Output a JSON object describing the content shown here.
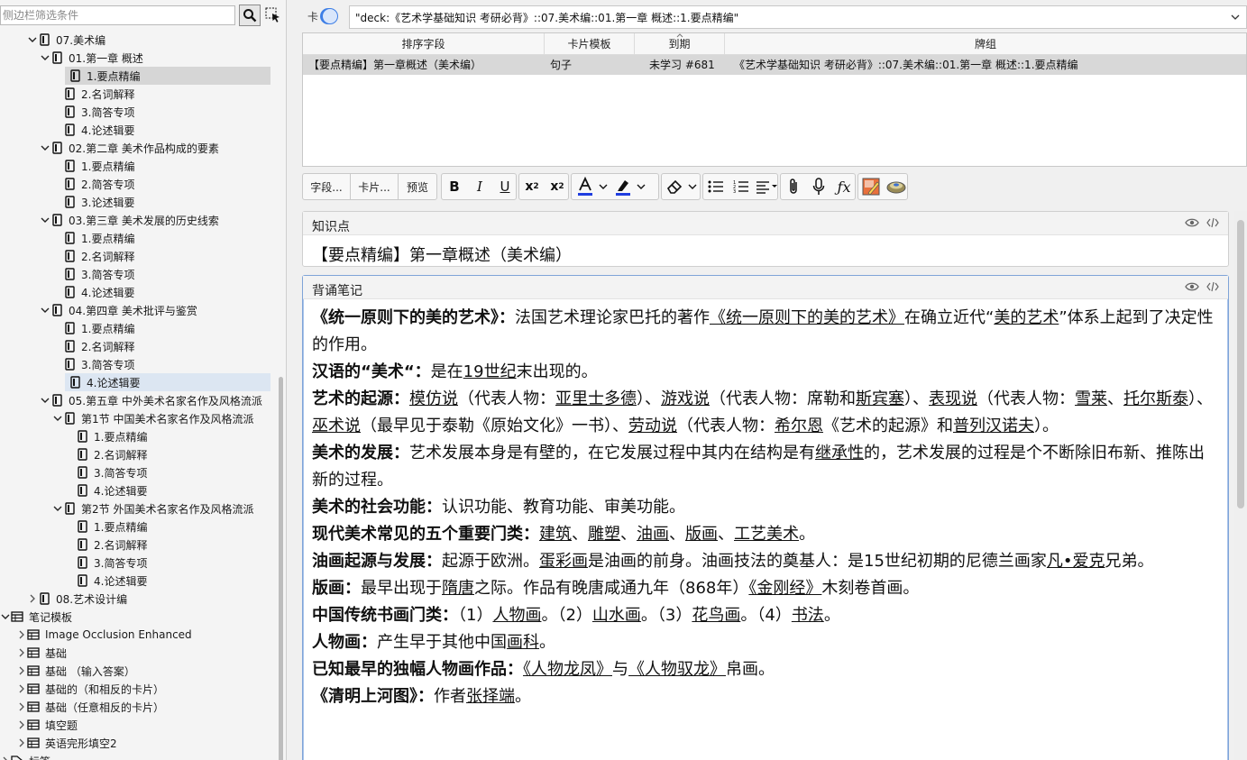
{
  "sidebar": {
    "search_placeholder": "侧边栏筛选条件",
    "tree": [
      {
        "label": "07.美术编",
        "indent": 0,
        "chev": "down",
        "icon": "deck"
      },
      {
        "label": "01.第一章 概述",
        "indent": 1,
        "chev": "down",
        "icon": "deck"
      },
      {
        "label": "1.要点精编",
        "indent": 2,
        "chev": "",
        "icon": "deck",
        "state": "selected"
      },
      {
        "label": "2.名词解释",
        "indent": 2,
        "chev": "",
        "icon": "deck"
      },
      {
        "label": "3.简答专项",
        "indent": 2,
        "chev": "",
        "icon": "deck"
      },
      {
        "label": "4.论述辑要",
        "indent": 2,
        "chev": "",
        "icon": "deck"
      },
      {
        "label": "02.第二章 美术作品构成的要素",
        "indent": 1,
        "chev": "down",
        "icon": "deck"
      },
      {
        "label": "1.要点精编",
        "indent": 2,
        "chev": "",
        "icon": "deck"
      },
      {
        "label": "2.简答专项",
        "indent": 2,
        "chev": "",
        "icon": "deck"
      },
      {
        "label": "3.论述辑要",
        "indent": 2,
        "chev": "",
        "icon": "deck"
      },
      {
        "label": "03.第三章 美术发展的历史线索",
        "indent": 1,
        "chev": "down",
        "icon": "deck"
      },
      {
        "label": "1.要点精编",
        "indent": 2,
        "chev": "",
        "icon": "deck"
      },
      {
        "label": "2.名词解释",
        "indent": 2,
        "chev": "",
        "icon": "deck"
      },
      {
        "label": "3.简答专项",
        "indent": 2,
        "chev": "",
        "icon": "deck"
      },
      {
        "label": "4.论述辑要",
        "indent": 2,
        "chev": "",
        "icon": "deck"
      },
      {
        "label": "04.第四章 美术批评与鉴赏",
        "indent": 1,
        "chev": "down",
        "icon": "deck"
      },
      {
        "label": "1.要点精编",
        "indent": 2,
        "chev": "",
        "icon": "deck"
      },
      {
        "label": "2.名词解释",
        "indent": 2,
        "chev": "",
        "icon": "deck"
      },
      {
        "label": "3.简答专项",
        "indent": 2,
        "chev": "",
        "icon": "deck"
      },
      {
        "label": "4.论述辑要",
        "indent": 2,
        "chev": "",
        "icon": "deck",
        "state": "hl"
      },
      {
        "label": "05.第五章 中外美术名家名作及风格流派",
        "indent": 1,
        "chev": "down",
        "icon": "deck"
      },
      {
        "label": "第1节 中国美术名家名作及风格流派",
        "indent": 2,
        "chev": "down",
        "icon": "deck"
      },
      {
        "label": "1.要点精编",
        "indent": 3,
        "chev": "",
        "icon": "deck"
      },
      {
        "label": "2.名词解释",
        "indent": 3,
        "chev": "",
        "icon": "deck"
      },
      {
        "label": "3.简答专项",
        "indent": 3,
        "chev": "",
        "icon": "deck"
      },
      {
        "label": "4.论述辑要",
        "indent": 3,
        "chev": "",
        "icon": "deck"
      },
      {
        "label": "第2节 外国美术名家名作及风格流派",
        "indent": 2,
        "chev": "down",
        "icon": "deck"
      },
      {
        "label": "1.要点精编",
        "indent": 3,
        "chev": "",
        "icon": "deck"
      },
      {
        "label": "2.名词解释",
        "indent": 3,
        "chev": "",
        "icon": "deck"
      },
      {
        "label": "3.简答专项",
        "indent": 3,
        "chev": "",
        "icon": "deck"
      },
      {
        "label": "4.论述辑要",
        "indent": 3,
        "chev": "",
        "icon": "deck"
      },
      {
        "label": "08.艺术设计编",
        "indent": 0,
        "chev": "right",
        "icon": "deck"
      },
      {
        "label": "笔记模板",
        "indent": -2,
        "chev": "down",
        "icon": "notetype"
      },
      {
        "label": "Image Occlusion Enhanced",
        "indent": -1,
        "chev": "right",
        "icon": "notetype"
      },
      {
        "label": "基础",
        "indent": -1,
        "chev": "right",
        "icon": "notetype"
      },
      {
        "label": "基础 （输入答案）",
        "indent": -1,
        "chev": "right",
        "icon": "notetype"
      },
      {
        "label": "基础的（和相反的卡片）",
        "indent": -1,
        "chev": "right",
        "icon": "notetype"
      },
      {
        "label": "基础（任意相反的卡片）",
        "indent": -1,
        "chev": "right",
        "icon": "notetype"
      },
      {
        "label": "填空题",
        "indent": -1,
        "chev": "right",
        "icon": "notetype"
      },
      {
        "label": "英语完形填空2",
        "indent": -1,
        "chev": "right",
        "icon": "notetype"
      },
      {
        "label": "标签",
        "indent": -2,
        "chev": "right",
        "icon": "tag"
      }
    ]
  },
  "topbar": {
    "toggle_label": "卡",
    "query": "\"deck:《艺术学基础知识 考研必背》::07.美术编::01.第一章 概述::1.要点精编\""
  },
  "table": {
    "columns": [
      "排序字段",
      "卡片模板",
      "到期",
      "牌组"
    ],
    "rows": [
      [
        "【要点精编】第一章概述（美术编）",
        "句子",
        "未学习 #681",
        "《艺术学基础知识 考研必背》::07.美术编::01.第一章 概述::1.要点精编"
      ]
    ]
  },
  "toolbar": {
    "fields_label": "字段...",
    "cards_label": "卡片...",
    "preview_label": "预览"
  },
  "fields": {
    "field1_label": "知识点",
    "field1_value": "【要点精编】第一章概述（美术编）",
    "field2_label": "背诵笔记"
  },
  "colors": {
    "accent": "#3d7ee6",
    "font_color_bar": "#1f3de0",
    "highlight_bar": "#1f3de0",
    "selected_row": "#d8d8d8"
  }
}
